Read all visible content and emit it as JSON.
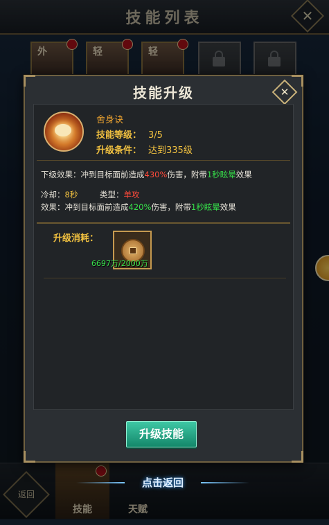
{
  "background": {
    "title": "技能列表",
    "close_icon": "close-x",
    "heroes": [
      {
        "tag": "外",
        "badge": true,
        "locked": false
      },
      {
        "tag": "轻",
        "badge": true,
        "locked": false
      },
      {
        "tag": "轻",
        "badge": true,
        "locked": false
      },
      {
        "tag": "",
        "badge": false,
        "locked": true
      },
      {
        "tag": "",
        "badge": false,
        "locked": true
      }
    ],
    "bottom": {
      "return_label": "返回",
      "tabs": [
        {
          "label": "技能",
          "active": true
        },
        {
          "label": "天赋",
          "active": false
        }
      ],
      "back_hint": "点击返回"
    }
  },
  "dialog": {
    "title": "技能升级",
    "skill": {
      "name": "舍身诀",
      "level_label": "技能等级：",
      "level_value": "3/5",
      "condition_label": "升级条件：",
      "condition_value": "达到335级"
    },
    "next_effect": {
      "prefix": "下级效果：冲到目标面前造成",
      "pct": "430%",
      "mid": "伤害，附带",
      "stun": "1秒眩晕",
      "suffix": "效果"
    },
    "cooldown_label": "冷却：",
    "cooldown_value": "8秒",
    "type_label": "类型：",
    "type_value": "单攻",
    "current_effect": {
      "prefix": "效果：冲到目标面前造成",
      "pct": "420%",
      "mid": "伤害，附带",
      "stun": "1秒眩晕",
      "suffix": "效果"
    },
    "cost_label": "升级消耗：",
    "cost_item": {
      "icon": "coin-stack",
      "count": "6697万/2000万"
    },
    "upgrade_button": "升级技能"
  },
  "colors": {
    "accent_gold": "#f0c040",
    "highlight_red": "#ff4a3a",
    "highlight_green": "#36e04a",
    "button_teal": "#1fa583"
  }
}
